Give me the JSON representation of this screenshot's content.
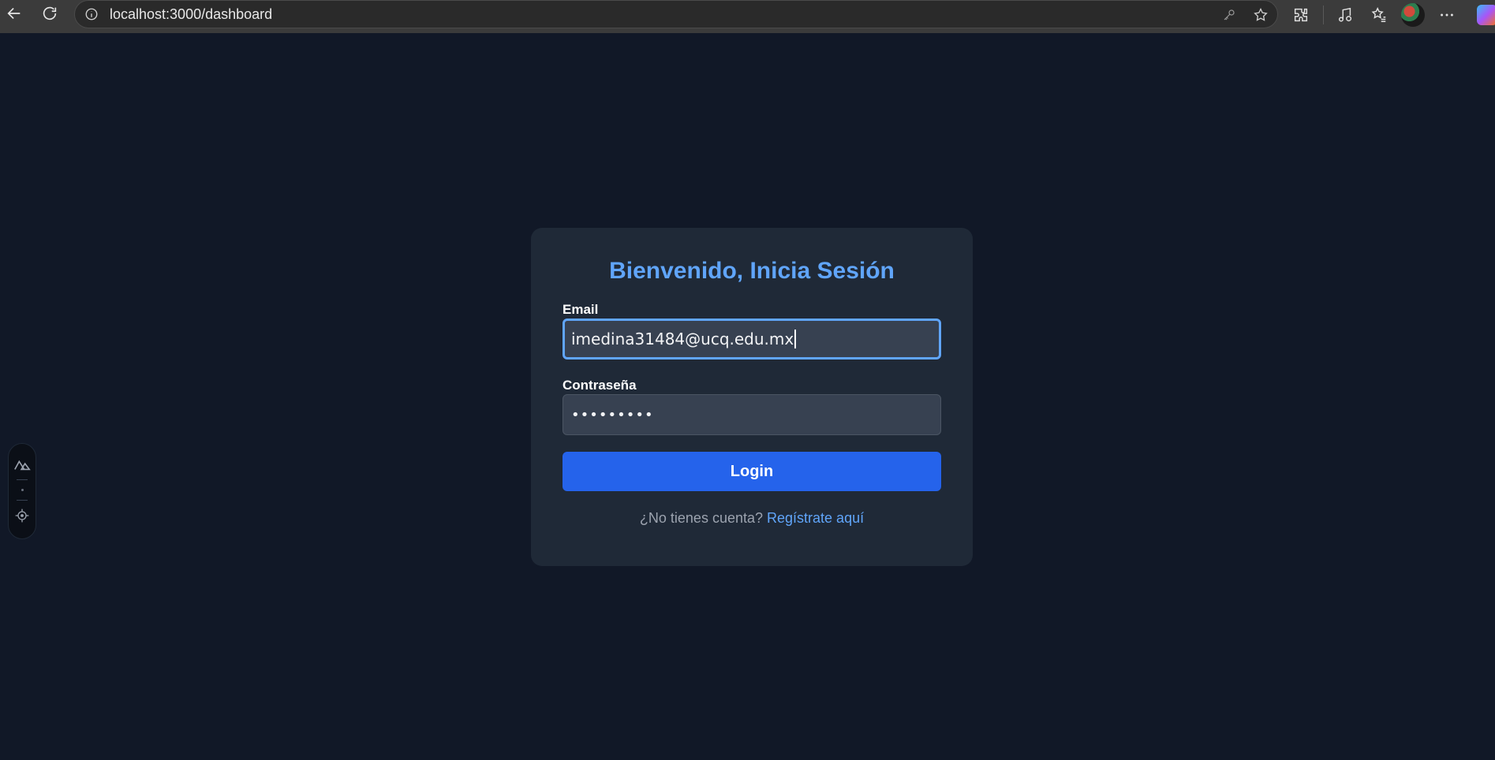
{
  "browser": {
    "url": "localhost:3000/dashboard"
  },
  "login": {
    "title": "Bienvenido, Inicia Sesión",
    "email_label": "Email",
    "email_value": "imedina31484@ucq.edu.mx",
    "password_label": "Contraseña",
    "password_value": "•••••••••",
    "submit_label": "Login",
    "footer_text": "¿No tienes cuenta?",
    "register_link": "Regístrate aquí"
  },
  "colors": {
    "page_bg": "#111827",
    "card_bg": "#1f2937",
    "accent": "#60a5fa",
    "button": "#2563eb"
  }
}
